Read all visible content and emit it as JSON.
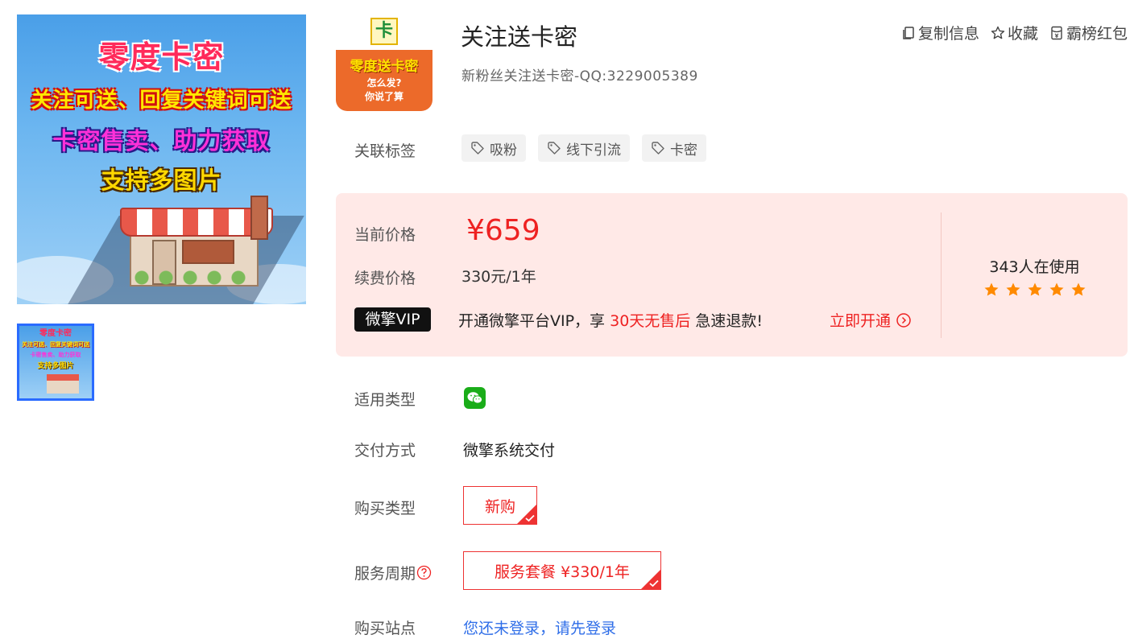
{
  "gallery": {
    "main_lines": [
      "零度卡密",
      "关注可送、回复关键词可送",
      "卡密售卖、助力获取",
      "支持多图片"
    ],
    "thumb_lines": [
      "零度卡密",
      "关注可送、回复关键词可送",
      "卡密售卖、助力获取",
      "支持多图片"
    ]
  },
  "logo": {
    "mark": "卡",
    "line1": "零度送卡密",
    "line2": "怎么发?",
    "line3": "你说了算"
  },
  "header": {
    "title": "关注送卡密",
    "subtitle": "新粉丝关注送卡密-QQ:3229005389",
    "actions": [
      {
        "label": "复制信息",
        "icon": "copy-icon"
      },
      {
        "label": "收藏",
        "icon": "star-outline-icon"
      },
      {
        "label": "霸榜红包",
        "icon": "red-packet-icon"
      }
    ]
  },
  "tags": {
    "label": "关联标签",
    "items": [
      "吸粉",
      "线下引流",
      "卡密"
    ]
  },
  "price": {
    "current_label": "当前价格",
    "current_value": "¥659",
    "renew_label": "续费价格",
    "renew_value": "330元/1年",
    "vip_badge": "微擎VIP",
    "vip_text_before": "开通微擎平台VIP，享 ",
    "vip_text_highlight": "30天无售后",
    "vip_text_after": " 急速退款!",
    "vip_link": "立即开通",
    "users_text": "343人在使用",
    "rating": 5,
    "star_color": "#ff8a00"
  },
  "details": {
    "type_label": "适用类型",
    "type_icon": "wechat-icon",
    "delivery_label": "交付方式",
    "delivery_value": "微擎系统交付",
    "purchase_label": "购买类型",
    "purchase_option": "新购",
    "period_label": "服务周期",
    "period_option": "服务套餐 ¥330/1年",
    "site_label": "购买站点",
    "site_value": "您还未登录，请先登录"
  },
  "colors": {
    "accent_red": "#ee2222",
    "link_blue": "#2f6ee8",
    "price_box_bg": "#ffe9e7",
    "wechat_green": "#1aad19"
  }
}
